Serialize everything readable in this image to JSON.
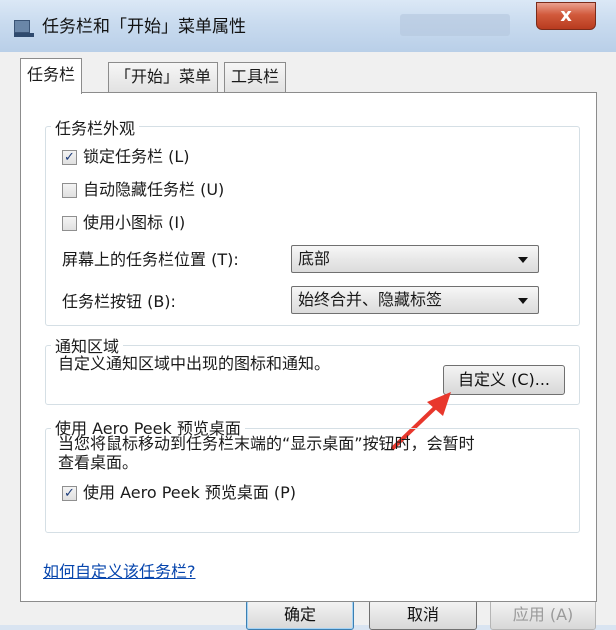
{
  "window": {
    "title": "任务栏和「开始」菜单属性",
    "close_label": "x"
  },
  "tabs": [
    {
      "label": "任务栏"
    },
    {
      "label": "「开始」菜单"
    },
    {
      "label": "工具栏"
    }
  ],
  "appearance": {
    "title": "任务栏外观",
    "lock": {
      "label": "锁定任务栏 (L)",
      "checked": true
    },
    "autohide": {
      "label": "自动隐藏任务栏 (U)",
      "checked": false
    },
    "small_icons": {
      "label": "使用小图标 (I)",
      "checked": false
    },
    "position_label": "屏幕上的任务栏位置 (T):",
    "position_value": "底部",
    "buttons_label": "任务栏按钮 (B):",
    "buttons_value": "始终合并、隐藏标签"
  },
  "notification": {
    "title": "通知区域",
    "description": "自定义通知区域中出现的图标和通知。",
    "customize_button": "自定义 (C)..."
  },
  "aero_peek": {
    "title": "使用 Aero Peek 预览桌面",
    "description_line1": "当您将鼠标移动到任务栏末端的“显示桌面”按钮时，会暂时",
    "description_line2": "查看桌面。",
    "checkbox": {
      "label": "使用 Aero Peek 预览桌面 (P)",
      "checked": true
    }
  },
  "help_link": "如何自定义该任务栏?",
  "footer": {
    "ok": "确定",
    "cancel": "取消",
    "apply": "应用 (A)"
  },
  "colors": {
    "annotation_arrow": "#e8372c",
    "link": "#0645ad"
  }
}
